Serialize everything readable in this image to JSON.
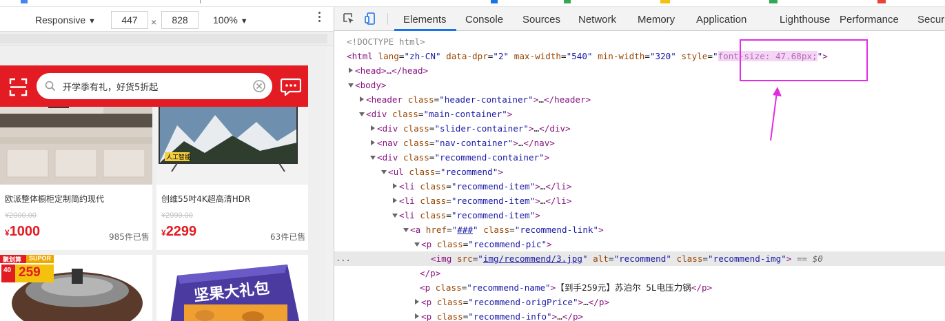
{
  "device_toolbar": {
    "mode": "Responsive",
    "width": "447",
    "times": "×",
    "height": "828",
    "zoom": "100%"
  },
  "phone": {
    "search_placeholder": "开学季有礼，好货5折起",
    "products": [
      {
        "name": "欧派整体橱柜定制简约现代",
        "orig_price": "¥2000.00",
        "currency": "¥",
        "price": "1000",
        "sold": "985件已售"
      },
      {
        "name": "创维55吋4K超高清HDR",
        "orig_price": "¥2999.00",
        "currency": "¥",
        "price": "2299",
        "sold": "63件已售"
      }
    ],
    "tv_badge": "人工智能",
    "promo_badge_1": "聚划算",
    "promo_badge_2": "SUPOR",
    "promo_badge_3": "259",
    "promo_badge_4": "40",
    "box_text": "坚果大礼包"
  },
  "devtools": {
    "tabs": [
      "Elements",
      "Console",
      "Sources",
      "Network",
      "Memory",
      "Application",
      "Lighthouse",
      "Performance",
      "Securi"
    ],
    "active_tab": "Elements",
    "dom": {
      "doctype": "<!DOCTYPE html>",
      "html_open": "<html",
      "html_attrs": [
        {
          "name": "lang",
          "value": "\"zh-CN\""
        },
        {
          "name": "data-dpr",
          "value": "\"2\""
        },
        {
          "name": "max-width",
          "value": "\"540\""
        },
        {
          "name": "min-width",
          "value": "\"320\""
        }
      ],
      "style_attr": "style",
      "style_value": "font-size: 47.68px;",
      "head_line": "<head>…</head>",
      "body_open": "<body>",
      "header_line": {
        "tag": "header",
        "cls": "header-container"
      },
      "main_div": {
        "tag": "div",
        "cls": "main-container"
      },
      "slider_div": {
        "tag": "div",
        "cls": "slider-container"
      },
      "nav_line": {
        "tag": "nav",
        "cls": "nav-container"
      },
      "recommend_div": {
        "tag": "div",
        "cls": "recommend-container"
      },
      "ul_line": {
        "tag": "ul",
        "cls": "recommend"
      },
      "li_cls": "recommend-item",
      "a_href": "###",
      "a_cls": "recommend-link",
      "p_pic_cls": "recommend-pic",
      "img_src": "img/recommend/3.jpg",
      "img_alt": "recommend",
      "img_cls": "recommend-img",
      "img_eq": "== $0",
      "p_close": "</p>",
      "p_name_cls": "recommend-name",
      "p_name_text": "【到手259元】苏泊尔 5L电压力锅",
      "p_orig_cls": "recommend-origPrice",
      "p_info_cls": "recommend-info"
    }
  },
  "colors": {
    "header_red": "#e31b23",
    "price_red": "#e31b23",
    "annotation_magenta": "#e12de1",
    "tab_blue": "#1a73e8"
  },
  "icons": [
    "scan-icon",
    "search-icon",
    "clear-icon",
    "message-icon",
    "inspect-icon",
    "device-toggle-icon",
    "more-vert-icon"
  ]
}
